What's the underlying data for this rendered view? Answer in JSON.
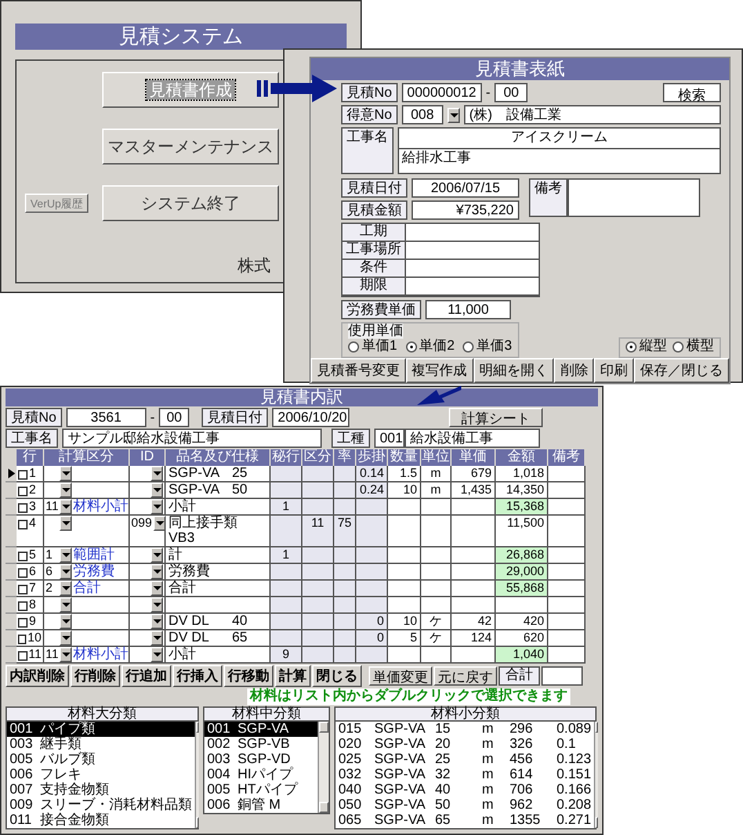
{
  "launcher": {
    "title": "見積システム",
    "menu_buttons": [
      {
        "label": "見積書作成",
        "focused": true
      },
      {
        "label": "マスターメンテナンス",
        "focused": false
      },
      {
        "label": "システム終了",
        "focused": false
      }
    ],
    "version_button": "VerUp履歴",
    "footer": "株式"
  },
  "cover_sheet": {
    "title": "見積書表紙",
    "estimate_no": {
      "label": "見積No",
      "value": "000000012",
      "dash": "-",
      "revision": "00"
    },
    "search_button": "検索",
    "customer": {
      "label": "得意No",
      "code": "008",
      "name": "(株)　設備工業"
    },
    "project": {
      "label": "工事名",
      "lines": [
        "アイスクリーム",
        "給排水工事"
      ]
    },
    "date": {
      "label": "見積日付",
      "value": "2006/07/15"
    },
    "amount": {
      "label": "見積金額",
      "value": "¥735,220"
    },
    "remarks": {
      "label": "備考"
    },
    "conditions": [
      {
        "label": "工期"
      },
      {
        "label": "工事場所"
      },
      {
        "label": "条件"
      },
      {
        "label": "期限"
      }
    ],
    "labor_rate": {
      "label": "労務費単価",
      "value": "11,000"
    },
    "rate_choice": {
      "label": "使用単価",
      "options": [
        {
          "label": "単価1",
          "selected": false
        },
        {
          "label": "単価2",
          "selected": true
        },
        {
          "label": "単価3",
          "selected": false
        }
      ]
    },
    "orientation": [
      {
        "label": "縦型",
        "selected": true
      },
      {
        "label": "横型",
        "selected": false
      }
    ],
    "buttons": [
      "見積番号変更",
      "複写作成",
      "明細を開く",
      "削除",
      "印刷",
      "保存／閉じる"
    ]
  },
  "detail": {
    "title": "見積書内訳",
    "estimate_no": {
      "label": "見積No",
      "value": "3561",
      "dash": "-",
      "revision": "00"
    },
    "date": {
      "label": "見積日付",
      "value": "2006/10/20"
    },
    "sheet_button": "計算シート",
    "project": {
      "label": "工事名",
      "value": "サンプル邸給水設備工事"
    },
    "work_type": {
      "label": "工種",
      "code": "001",
      "name": "給水設備工事"
    },
    "columns": [
      "行",
      "計算区分",
      "ID",
      "品名及び仕様",
      "秘行",
      "区分",
      "率",
      "歩掛",
      "数量",
      "単位",
      "単価",
      "金額",
      "備考"
    ],
    "rows": [
      {
        "n": "1",
        "selected": true,
        "checked": false,
        "name": "SGP-VA",
        "spec": "25",
        "labor": "0.14",
        "qty": "1.5",
        "unit": "m",
        "price": "679",
        "amount": "1,018",
        "subtotal": false
      },
      {
        "n": "2",
        "selected": false,
        "checked": false,
        "name": "SGP-VA",
        "spec": "50",
        "labor": "0.24",
        "qty": "10",
        "unit": "m",
        "price": "1,435",
        "amount": "14,350",
        "subtotal": false
      },
      {
        "n": "3",
        "selected": false,
        "checked": false,
        "calc_code": "11",
        "calc_label": "材料小計",
        "name": "小計",
        "hidden": "1",
        "amount": "15,368",
        "subtotal": true
      },
      {
        "n": "4",
        "selected": false,
        "checked": false,
        "id": "099",
        "name": "同上接手類",
        "name_2": "VB3",
        "division": "11",
        "rate": "75",
        "amount": "11,500",
        "subtotal": false
      },
      {
        "n": "5",
        "selected": false,
        "checked": false,
        "calc_code": "1",
        "calc_label": "範囲計",
        "name": "計",
        "hidden": "1",
        "amount": "26,868",
        "subtotal": true
      },
      {
        "n": "6",
        "selected": false,
        "checked": false,
        "calc_code": "6",
        "calc_label": "労務費",
        "name": "労務費",
        "amount": "29,000",
        "subtotal": true
      },
      {
        "n": "7",
        "selected": false,
        "checked": false,
        "calc_code": "2",
        "calc_label": "合計",
        "name": "合計",
        "amount": "55,868",
        "subtotal": true
      },
      {
        "n": "8",
        "selected": false,
        "checked": false,
        "subtotal": false
      },
      {
        "n": "9",
        "selected": false,
        "checked": false,
        "name": "DV DL",
        "spec": "40",
        "labor": "0",
        "qty": "10",
        "unit": "ケ",
        "price": "42",
        "amount": "420",
        "subtotal": false
      },
      {
        "n": "10",
        "selected": false,
        "checked": false,
        "name": "DV DL",
        "spec": "65",
        "labor": "0",
        "qty": "5",
        "unit": "ケ",
        "price": "124",
        "amount": "620",
        "subtotal": false
      },
      {
        "n": "11",
        "selected": false,
        "checked": false,
        "calc_code": "11",
        "calc_label": "材料小計",
        "name": "小計",
        "hidden": "9",
        "amount": "1,040",
        "subtotal": true
      }
    ],
    "buttons": [
      "内訳削除",
      "行削除",
      "行追加",
      "行挿入",
      "行移動",
      "計算",
      "閉じる"
    ],
    "small_buttons": [
      "単価変更",
      "元に戻す"
    ],
    "total_label": "合計",
    "hint": "材料はリスト内からダブルクリックで選択できます",
    "lists": [
      {
        "title": "材料大分類",
        "items": [
          {
            "cells": [
              "001",
              "パイプ類"
            ],
            "selected": true
          },
          {
            "cells": [
              "003",
              "継手類"
            ],
            "selected": false
          },
          {
            "cells": [
              "005",
              "バルブ類"
            ],
            "selected": false
          },
          {
            "cells": [
              "006",
              "フレキ"
            ],
            "selected": false
          },
          {
            "cells": [
              "007",
              "支持金物類"
            ],
            "selected": false
          },
          {
            "cells": [
              "009",
              "スリーブ・消耗材料品類"
            ],
            "selected": false
          },
          {
            "cells": [
              "011",
              "接合金物類"
            ],
            "selected": false
          }
        ]
      },
      {
        "title": "材料中分類",
        "items": [
          {
            "cells": [
              "001",
              "SGP-VA"
            ],
            "selected": true
          },
          {
            "cells": [
              "002",
              "SGP-VB"
            ],
            "selected": false
          },
          {
            "cells": [
              "003",
              "SGP-VD"
            ],
            "selected": false
          },
          {
            "cells": [
              "004",
              "HIパイプ"
            ],
            "selected": false
          },
          {
            "cells": [
              "005",
              "HTパイプ"
            ],
            "selected": false
          },
          {
            "cells": [
              "006",
              "銅管 M"
            ],
            "selected": false
          }
        ]
      },
      {
        "title": "材料小分類",
        "items": [
          {
            "cells": [
              "015",
              "SGP-VA",
              "15",
              "m",
              "296",
              "0.089"
            ],
            "selected": false
          },
          {
            "cells": [
              "020",
              "SGP-VA",
              "20",
              "m",
              "326",
              "0.1"
            ],
            "selected": false
          },
          {
            "cells": [
              "025",
              "SGP-VA",
              "25",
              "m",
              "456",
              "0.123"
            ],
            "selected": false
          },
          {
            "cells": [
              "032",
              "SGP-VA",
              "32",
              "m",
              "614",
              "0.151"
            ],
            "selected": false
          },
          {
            "cells": [
              "040",
              "SGP-VA",
              "40",
              "m",
              "706",
              "0.166"
            ],
            "selected": false
          },
          {
            "cells": [
              "050",
              "SGP-VA",
              "50",
              "m",
              "962",
              "0.208"
            ],
            "selected": false
          },
          {
            "cells": [
              "065",
              "SGP-VA",
              "65",
              "m",
              "1355",
              "0.271"
            ],
            "selected": false
          }
        ]
      }
    ]
  }
}
